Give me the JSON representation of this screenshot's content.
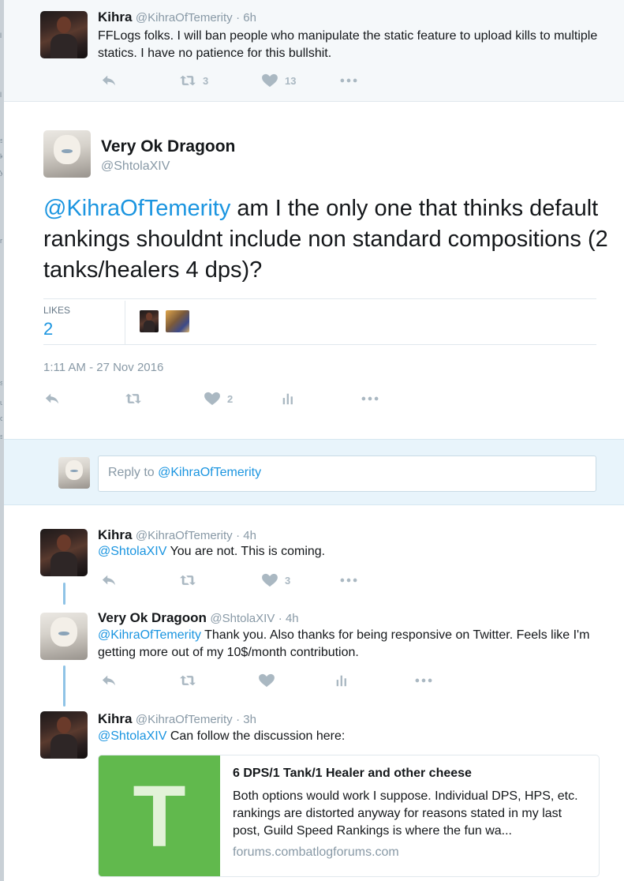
{
  "edge_glyphs": [
    "l",
    "l",
    "s",
    "k",
    "y",
    "r",
    "s",
    "u",
    "c",
    "s"
  ],
  "tweet1": {
    "name": "Kihra",
    "handle": "@KihraOfTemerity",
    "time": "· 6h",
    "text": "FFLogs folks. I will ban people who manipulate the static feature to upload kills to multiple statics. I have no patience for this bullshit.",
    "retweets": "3",
    "likes": "13"
  },
  "main_tweet": {
    "name": "Very Ok Dragoon",
    "handle": "@ShtolaXIV",
    "mention": "@KihraOfTemerity",
    "text": " am I the only one that thinks default rankings shouldnt include non standard compositions (2 tanks/healers 4 dps)?",
    "likes_label": "LIKES",
    "likes_count": "2",
    "timestamp": "1:11 AM - 27 Nov 2016",
    "action_like_count": "2"
  },
  "reply_box": {
    "prefix": "Reply to ",
    "mention": "@KihraOfTemerity"
  },
  "replies": [
    {
      "name": "Kihra",
      "handle": "@KihraOfTemerity",
      "time": "· 4h",
      "mention": "@ShtolaXIV",
      "text": " You are not. This is coming.",
      "likes": "3"
    },
    {
      "name": "Very Ok Dragoon",
      "handle": "@ShtolaXIV",
      "time": "· 4h",
      "mention": "@KihraOfTemerity",
      "text": " Thank you. Also thanks for being responsive on Twitter. Feels like I'm getting more out of my 10$/month contribution."
    },
    {
      "name": "Kihra",
      "handle": "@KihraOfTemerity",
      "time": "· 3h",
      "mention": "@ShtolaXIV",
      "text": " Can follow the discussion here:"
    }
  ],
  "card": {
    "thumb_letter": "T",
    "title": "6 DPS/1 Tank/1 Healer and other cheese",
    "description": "Both options would work I suppose. Individual DPS, HPS, etc. rankings are distorted anyway for reasons stated in my last post, Guild Speed Rankings is where the fun wa...",
    "domain": "forums.combatlogforums.com"
  },
  "colors": {
    "link": "#1b95e0",
    "icon": "#aab8c2",
    "muted": "#8899a6",
    "card_thumb": "#61b94d",
    "reply_bar": "#e8f4fb"
  },
  "icons": [
    "reply-icon",
    "retweet-icon",
    "heart-icon",
    "more-icon",
    "analytics-icon"
  ]
}
